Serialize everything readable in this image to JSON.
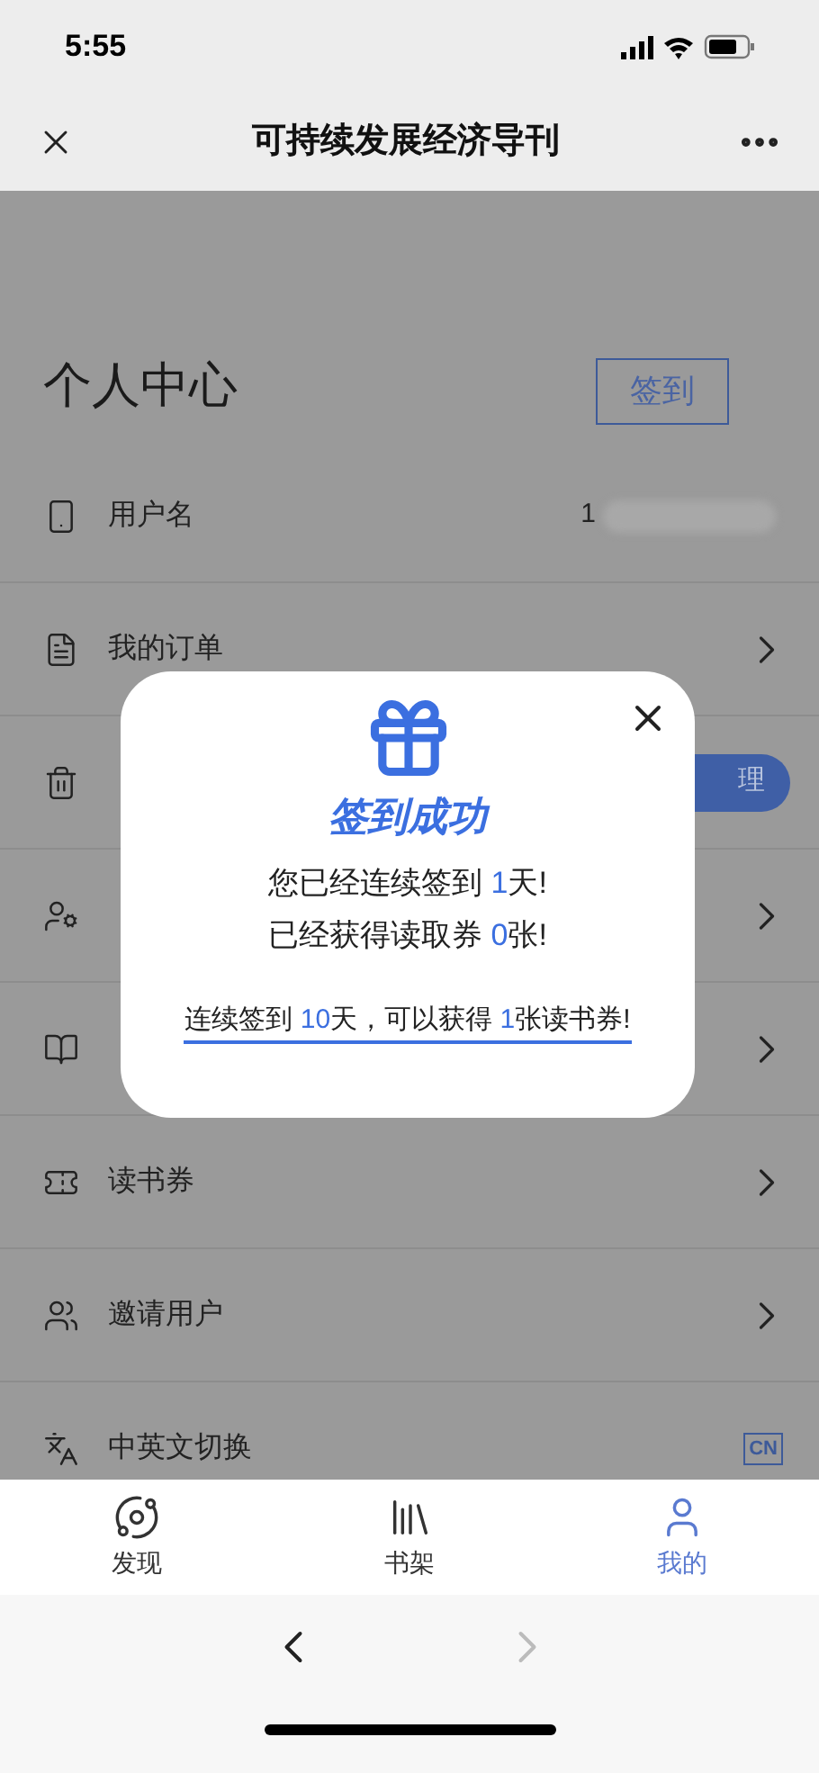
{
  "status_bar": {
    "time": "5:55"
  },
  "nav": {
    "title": "可持续发展经济导刊"
  },
  "page": {
    "title": "个人中心",
    "checkin_button": "签到"
  },
  "rows": [
    {
      "kind": "value",
      "label": "用户名",
      "value": "1"
    },
    {
      "kind": "chevron",
      "label": "我的订单"
    },
    {
      "kind": "button",
      "button": "理"
    },
    {
      "kind": "chevron"
    },
    {
      "kind": "chevron"
    },
    {
      "kind": "chevron",
      "label": "读书券"
    },
    {
      "kind": "chevron",
      "label": "邀请用户"
    },
    {
      "kind": "badge",
      "label": "中英文切换",
      "badge": "CN"
    }
  ],
  "dialog": {
    "title": "签到成功",
    "lines": [
      [
        {
          "kind": "plain",
          "text": "您已经连续签到 "
        },
        {
          "kind": "highlight",
          "text": "1"
        },
        {
          "kind": "plain",
          "text": "天!"
        }
      ],
      [
        {
          "kind": "plain",
          "text": "已经获得读取券 "
        },
        {
          "kind": "highlight",
          "text": "0"
        },
        {
          "kind": "plain",
          "text": "张!"
        }
      ]
    ],
    "note": [
      {
        "kind": "plain",
        "text": "连续签到 "
      },
      {
        "kind": "highlight",
        "text": "10"
      },
      {
        "kind": "plain",
        "text": "天，可以获得 "
      },
      {
        "kind": "highlight",
        "text": "1"
      },
      {
        "kind": "plain",
        "text": "张读书券!"
      }
    ]
  },
  "tabs": [
    {
      "label": "发现",
      "selected": false
    },
    {
      "label": "书架",
      "selected": false
    },
    {
      "label": "我的",
      "selected": true
    }
  ],
  "browser_bar": {
    "back_enabled": true,
    "forward_enabled": false
  }
}
